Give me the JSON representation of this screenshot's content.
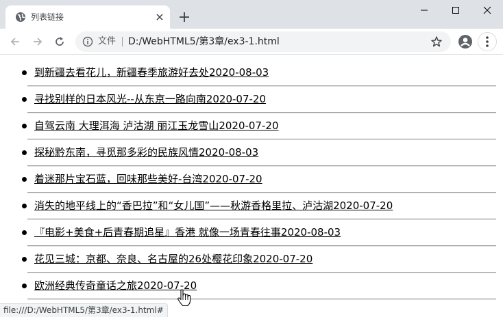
{
  "browser": {
    "tab_title": "列表链接",
    "scheme_label": "文件",
    "url": "D:/WebHTML5/第3章/ex3-1.html",
    "status_text": "file:///D:/WebHTML5/第3章/ex3-1.html#"
  },
  "news": {
    "items": [
      {
        "title": "到新疆去看花儿，新疆春季旅游好去处",
        "date": "2020-08-03"
      },
      {
        "title": "寻找别样的日本风光--从东京一路向南",
        "date": "2020-07-20"
      },
      {
        "title": "自驾云南 大理洱海 泸沽湖 丽江玉龙雪山",
        "date": "2020-07-20"
      },
      {
        "title": "探秘黔东南，寻觅那多彩的民族风情",
        "date": "2020-08-03"
      },
      {
        "title": "着迷那片宝石蓝，回味那些美好-台湾",
        "date": "2020-07-20"
      },
      {
        "title": "消失的地平线上的“香巴拉”和“女儿国”——秋游香格里拉、泸沽湖",
        "date": "2020-07-20"
      },
      {
        "title": "『电影+美食+后青春期追星』香港 就像一场青春往事",
        "date": "2020-08-03"
      },
      {
        "title": "花见三城：京都、奈良、名古屋的26处樱花印象",
        "date": "2020-07-20"
      },
      {
        "title": "欧洲经典传奇童话之旅",
        "date": "2020-07-20"
      }
    ]
  }
}
